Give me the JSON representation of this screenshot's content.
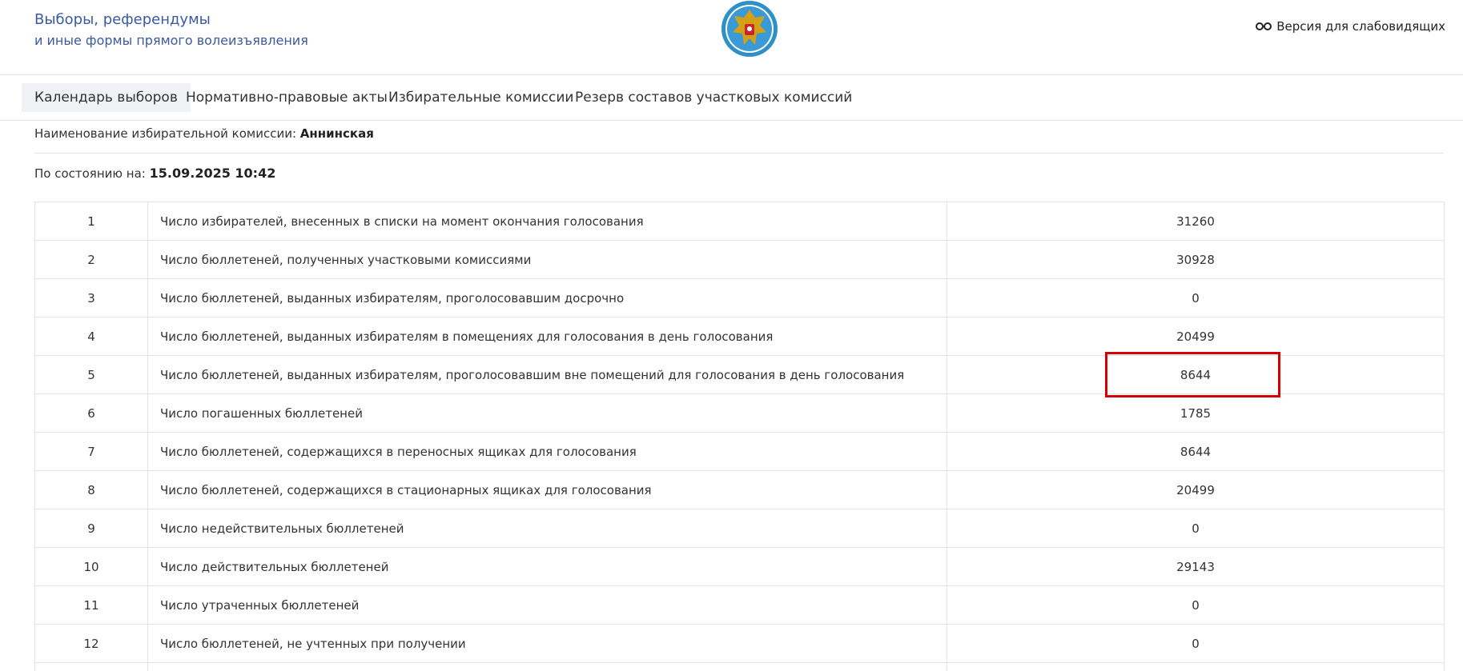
{
  "header": {
    "title": "Выборы, референдумы",
    "subtitle": "и иные формы прямого волеизъявления",
    "low_vision_label": "Версия для слабовидящих",
    "emblem_icon": "emblem-icon",
    "glasses_icon": "glasses-icon"
  },
  "nav": {
    "items": [
      {
        "label": "Календарь выборов",
        "active": true
      },
      {
        "label": "Нормативно-правовые акты",
        "active": false
      },
      {
        "label": "Избирательные комиссии",
        "active": false
      },
      {
        "label": "Резерв составов участковых комиссий",
        "active": false
      }
    ]
  },
  "info": {
    "commission_label": "Наименование избирательной комиссии:",
    "commission_name": "Аннинская",
    "status_label": "По состоянию на:",
    "status_datetime": "15.09.2025 10:42"
  },
  "table": {
    "rows": [
      {
        "num": "1",
        "label": "Число избирателей, внесенных в списки на момент окончания голосования",
        "value": "31260"
      },
      {
        "num": "2",
        "label": "Число бюллетеней, полученных участковыми комиссиями",
        "value": "30928"
      },
      {
        "num": "3",
        "label": "Число бюллетеней, выданных избирателям, проголосовавшим досрочно",
        "value": "0"
      },
      {
        "num": "4",
        "label": "Число бюллетеней, выданных избирателям в помещениях для голосования в день голосования",
        "value": "20499"
      },
      {
        "num": "5",
        "label": "Число бюллетеней, выданных избирателям, проголосовавшим вне помещений для голосования в день голосования",
        "value": "8644"
      },
      {
        "num": "6",
        "label": "Число погашенных бюллетеней",
        "value": "1785"
      },
      {
        "num": "7",
        "label": "Число бюллетеней, содержащихся в переносных ящиках для голосования",
        "value": "8644"
      },
      {
        "num": "8",
        "label": "Число бюллетеней, содержащихся в стационарных ящиках для голосования",
        "value": "20499"
      },
      {
        "num": "9",
        "label": "Число недействительных бюллетеней",
        "value": "0"
      },
      {
        "num": "10",
        "label": "Число действительных бюллетеней",
        "value": "29143"
      },
      {
        "num": "11",
        "label": "Число утраченных бюллетеней",
        "value": "0"
      },
      {
        "num": "12",
        "label": "Число бюллетеней, не учтенных при получении",
        "value": "0"
      },
      {
        "num": "",
        "label": "",
        "value": ""
      }
    ]
  },
  "colors": {
    "title": "#3b5aa0",
    "highlight": "#d60000",
    "border": "#e3e3e3",
    "nav_active_bg": "#f1f2f6"
  }
}
